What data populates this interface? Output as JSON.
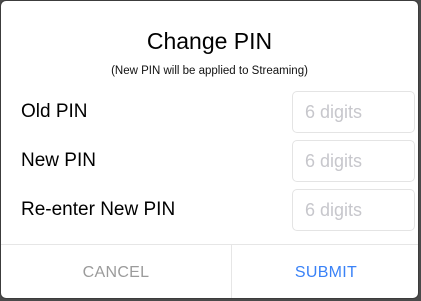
{
  "dialog": {
    "title": "Change PIN",
    "subtitle": "(New PIN will be applied to Streaming)"
  },
  "fields": [
    {
      "label": "Old PIN",
      "value": "",
      "placeholder": "6 digits"
    },
    {
      "label": "New PIN",
      "value": "",
      "placeholder": "6 digits"
    },
    {
      "label": "Re-enter New PIN",
      "value": "",
      "placeholder": "6 digits"
    }
  ],
  "buttons": {
    "cancel_label": "CANCEL",
    "submit_label": "SUBMIT"
  },
  "colors": {
    "accent": "#3a82f7",
    "disabled_text": "#9b9b9b",
    "placeholder": "#c7c7cc",
    "backdrop": "#4a4a4a"
  }
}
